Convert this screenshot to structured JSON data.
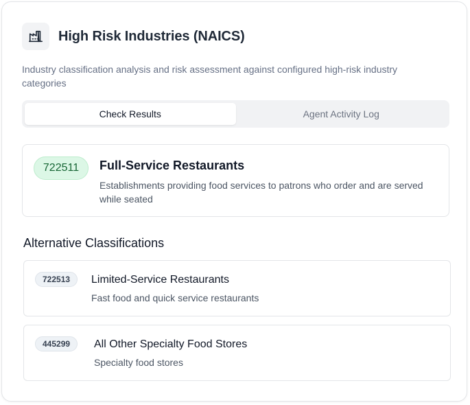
{
  "header": {
    "icon": "factory-icon",
    "title": "High Risk Industries (NAICS)",
    "description": "Industry classification analysis and risk assessment against configured high-risk industry categories"
  },
  "tabs": [
    {
      "label": "Check Results",
      "active": true
    },
    {
      "label": "Agent Activity Log",
      "active": false
    }
  ],
  "primary": {
    "code": "722511",
    "title": "Full-Service Restaurants",
    "description": "Establishments providing food services to patrons who order and are served while seated"
  },
  "alternatives": {
    "heading": "Alternative Classifications",
    "items": [
      {
        "code": "722513",
        "title": "Limited-Service Restaurants",
        "description": "Fast food and quick service restaurants"
      },
      {
        "code": "445299",
        "title": "All Other Specialty Food Stores",
        "description": "Specialty food stores"
      }
    ]
  },
  "colors": {
    "primary_badge_bg": "#dcf7e6",
    "primary_badge_text": "#166534",
    "muted_text": "#667085"
  }
}
